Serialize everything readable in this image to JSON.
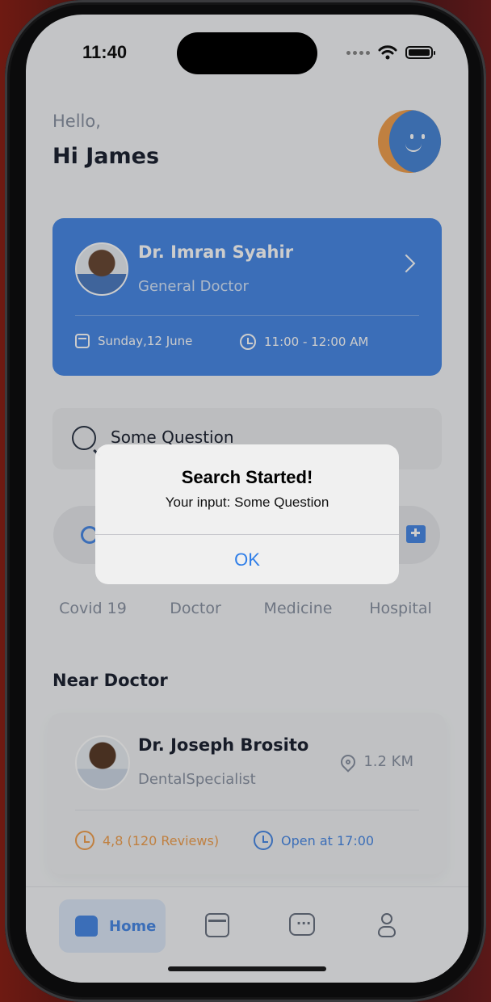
{
  "status_bar": {
    "time": "11:40"
  },
  "header": {
    "greeting": "Hello,",
    "user_name": "Hi James"
  },
  "appointment": {
    "doctor_name": "Dr. Imran Syahir",
    "doctor_role": "General Doctor",
    "date": "Sunday,12 June",
    "time": "11:00 - 12:00 AM"
  },
  "search": {
    "value": "Some Question"
  },
  "categories": [
    {
      "label": "Covid 19",
      "icon": "virus-icon"
    },
    {
      "label": "Doctor",
      "icon": "stethoscope-icon"
    },
    {
      "label": "Medicine",
      "icon": "pill-icon"
    },
    {
      "label": "Hospital",
      "icon": "hospital-icon"
    }
  ],
  "near_doctor": {
    "section_title": "Near Doctor",
    "name": "Dr. Joseph Brosito",
    "specialty": "DentalSpecialist",
    "distance": "1.2 KM",
    "rating": "4,8 (120 Reviews)",
    "open_time": "Open at 17:00"
  },
  "tab_bar": {
    "active": "Home",
    "items": [
      {
        "label": "Home",
        "icon": "home-icon"
      },
      {
        "label": "",
        "icon": "calendar-icon"
      },
      {
        "label": "",
        "icon": "chat-icon"
      },
      {
        "label": "",
        "icon": "profile-icon"
      }
    ]
  },
  "alert": {
    "title": "Search Started!",
    "message": "Your input: Some Question",
    "ok_label": "OK"
  },
  "colors": {
    "primary": "#4a8ae6",
    "accent_orange": "#f0a050",
    "text_dark": "#1d2433",
    "text_muted": "#8a93a3"
  }
}
